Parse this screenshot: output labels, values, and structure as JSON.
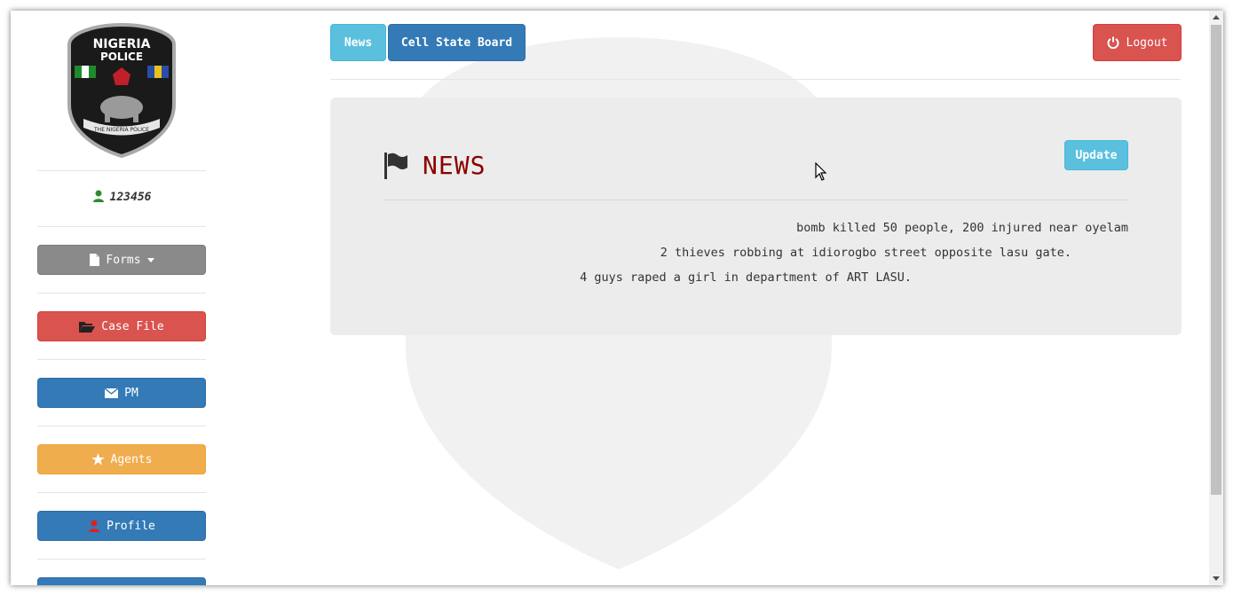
{
  "logo": {
    "line1": "NIGERIA",
    "line2": "POLICE",
    "ribbon": "THE NIGERIA POLICE"
  },
  "user": {
    "id": "123456",
    "icon": "user-icon",
    "icon_color": "#2e8b2e"
  },
  "sidebar": {
    "items": [
      {
        "label": "Forms",
        "icon": "file-icon",
        "color": "#8a8a8a",
        "has_caret": true
      },
      {
        "label": "Case File",
        "icon": "folder-open-icon",
        "color": "#d9534f"
      },
      {
        "label": "PM",
        "icon": "envelope-icon",
        "color": "#337ab7"
      },
      {
        "label": "Agents",
        "icon": "star-icon",
        "color": "#f0ad4e"
      },
      {
        "label": "Profile",
        "icon": "user-icon",
        "color": "#337ab7",
        "icon_color": "#e02020"
      }
    ]
  },
  "topnav": {
    "news_label": "News",
    "cell_label": "Cell State Board",
    "logout_label": "Logout"
  },
  "news_panel": {
    "title": "NEWS",
    "update_label": "Update",
    "items": [
      "bomb killed 50 people, 200 injured near oyelam",
      "2 thieves robbing at idiorogbo street opposite lasu gate.",
      "4 guys raped a girl in department of ART LASU."
    ]
  },
  "colors": {
    "info": "#5bc0de",
    "primary": "#337ab7",
    "danger": "#d9534f",
    "warning": "#f0ad4e",
    "title": "#8b0000"
  }
}
